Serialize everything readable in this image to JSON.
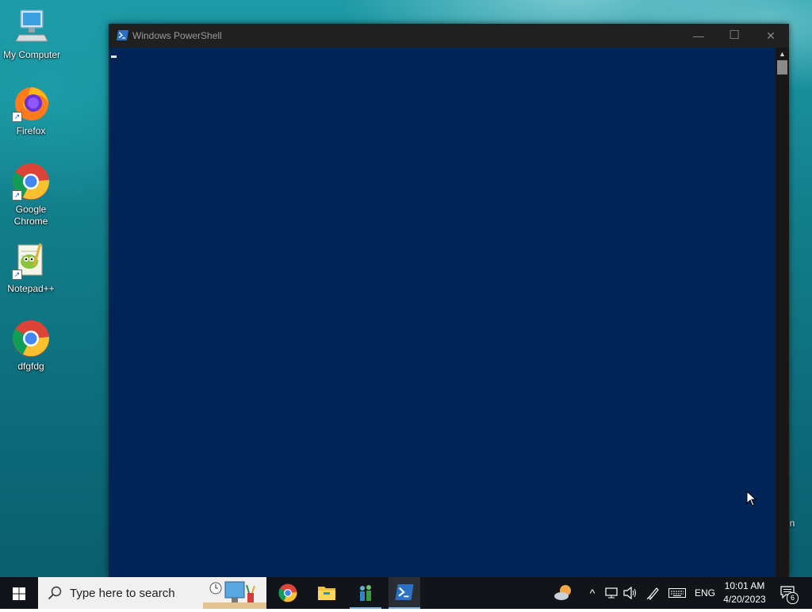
{
  "desktop": {
    "icons": [
      {
        "label": "My Computer"
      },
      {
        "label": "Firefox"
      },
      {
        "label": "Google Chrome"
      },
      {
        "label": "Notepad++"
      },
      {
        "label": "dfgfdg"
      }
    ],
    "edge_text": "in"
  },
  "window": {
    "title": "Windows PowerShell",
    "minimize_glyph": "—",
    "maximize_glyph": "☐",
    "close_glyph": "✕",
    "console_bg": "#012456",
    "scroll_up_glyph": "▲"
  },
  "taskbar": {
    "search_placeholder": "Type here to search",
    "pinned": [
      "chrome-icon",
      "file-explorer-icon",
      "app-icon",
      "powershell-icon"
    ],
    "tray": {
      "language": "ENG",
      "time": "10:01 AM",
      "date": "4/20/2023",
      "notification_count": "6"
    }
  }
}
